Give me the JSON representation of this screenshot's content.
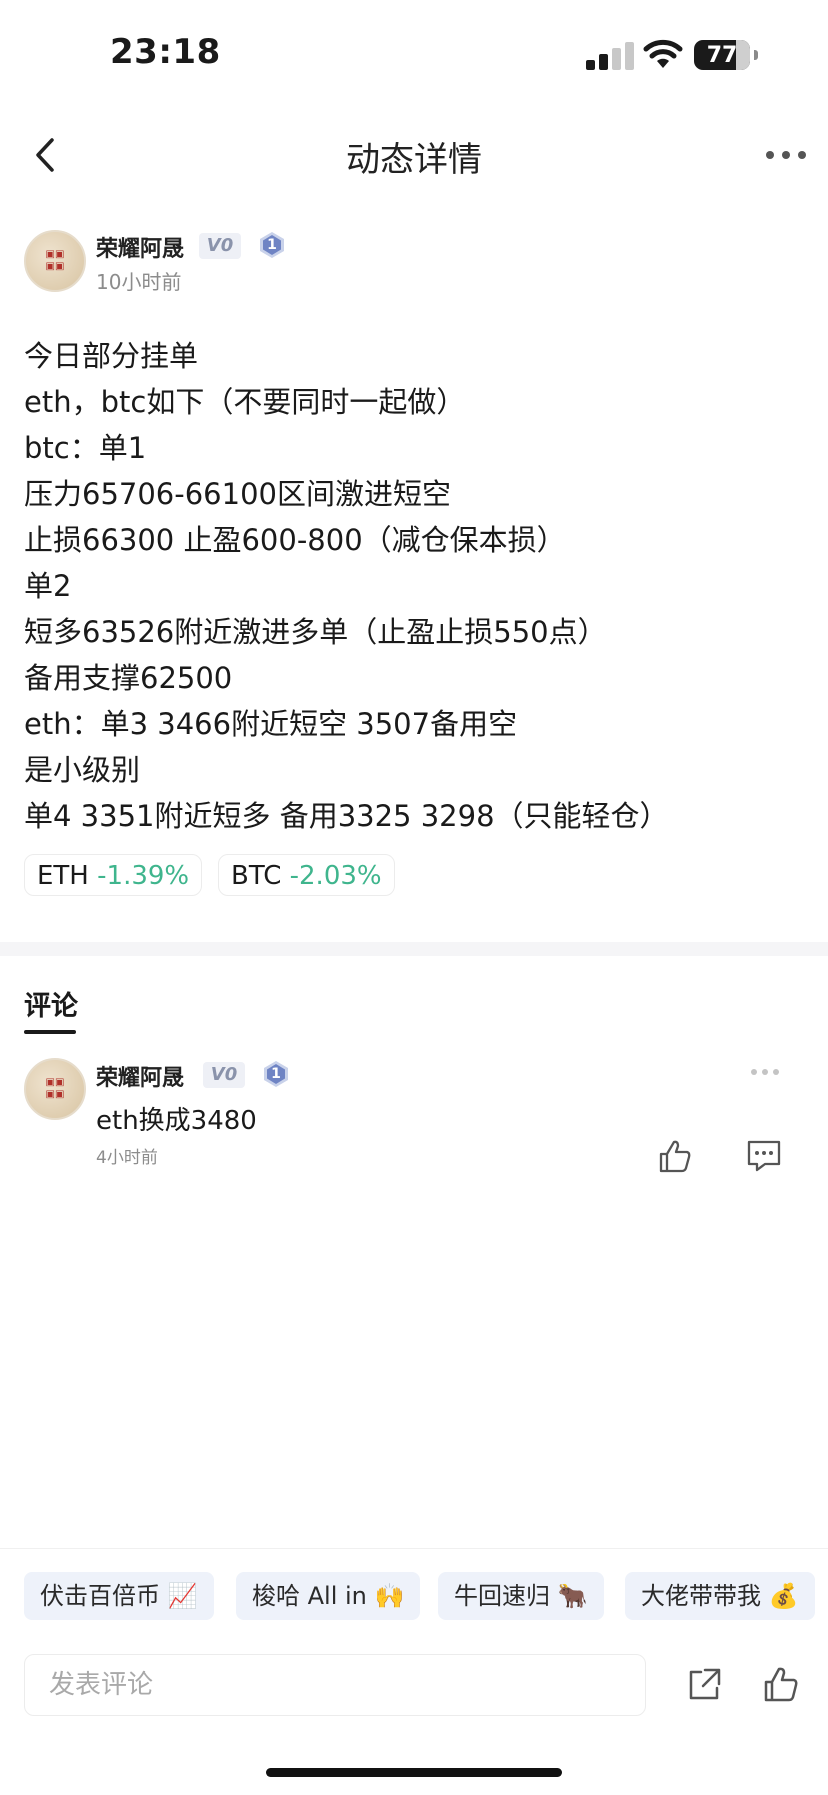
{
  "status_bar": {
    "time": "23:18",
    "battery": "77"
  },
  "nav": {
    "title": "动态详情"
  },
  "post": {
    "author": "荣耀阿晟",
    "vip_badge": "V0",
    "level": "1",
    "time": "10小时前",
    "lines": [
      "今日部分挂单",
      "eth，btc如下（不要同时一起做）",
      "btc：单1",
      "压力65706-66100区间激进短空",
      "止损66300 止盈600-800（减仓保本损）",
      "单2",
      "短多63526附近激进多单（止盈止损550点）",
      "备用支撑62500",
      "eth：单3 3466附近短空 3507备用空",
      "是小级别",
      "单4 3351附近短多 备用3325 3298（只能轻仓）"
    ],
    "tags": [
      {
        "symbol": "ETH",
        "change": "-1.39%"
      },
      {
        "symbol": "BTC",
        "change": "-2.03%"
      }
    ]
  },
  "comments": {
    "title": "评论",
    "items": [
      {
        "author": "荣耀阿晟",
        "vip_badge": "V0",
        "level": "1",
        "text": "eth换成3480",
        "time": "4小时前"
      }
    ]
  },
  "quick_replies": [
    "伏击百倍币 📈",
    "梭哈 All in 🙌",
    "牛回速归 🐂",
    "大佬带带我 💰"
  ],
  "input": {
    "placeholder": "发表评论"
  },
  "colors": {
    "positive_accent": "#3fb58d",
    "chip_bg": "#eef2fa"
  }
}
